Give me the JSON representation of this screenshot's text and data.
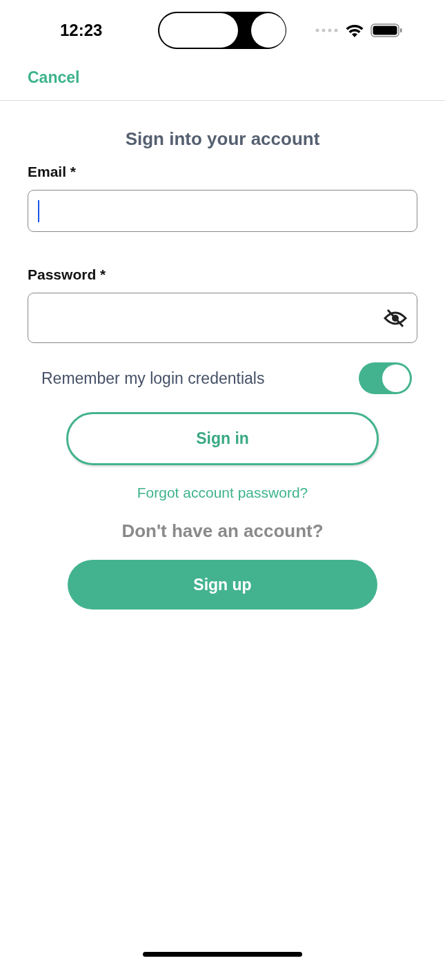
{
  "status_bar": {
    "time": "12:23"
  },
  "nav": {
    "cancel": "Cancel"
  },
  "title": "Sign into your account",
  "fields": [
    {
      "kind": "email",
      "label": "Email *",
      "focused": true
    },
    {
      "kind": "password",
      "label": "Password *",
      "focused": false
    }
  ],
  "remember": {
    "label": "Remember my login credentials",
    "on": true
  },
  "sign_in": "Sign in",
  "forgot": "Forgot account password?",
  "no_account": "Don't have an account?",
  "sign_up": "Sign up"
}
